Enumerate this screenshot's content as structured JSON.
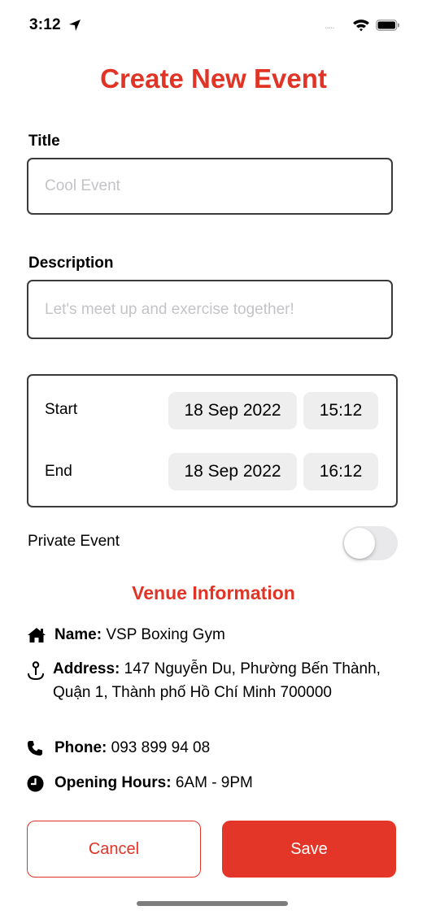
{
  "status_bar": {
    "time": "3:12",
    "signal_dots": "....."
  },
  "page": {
    "title": "Create New Event"
  },
  "form": {
    "title_label": "Title",
    "title_placeholder": "Cool Event",
    "description_label": "Description",
    "description_placeholder": "Let's meet up and exercise together!",
    "start_label": "Start",
    "start_date": "18 Sep 2022",
    "start_time": "15:12",
    "end_label": "End",
    "end_date": "18 Sep 2022",
    "end_time": "16:12",
    "private_label": "Private Event",
    "private_enabled": false
  },
  "venue": {
    "heading": "Venue Information",
    "name_label": "Name:",
    "name_value": "VSP Boxing Gym",
    "address_label": "Address:",
    "address_value": "147 Nguyễn Du, Phường Bến Thành, Quận 1, Thành phố Hồ Chí Minh 700000",
    "phone_label": "Phone:",
    "phone_value": "093 899 94 08",
    "hours_label": "Opening Hours:",
    "hours_value": "6AM - 9PM"
  },
  "actions": {
    "cancel_label": "Cancel",
    "save_label": "Save"
  },
  "icons": {
    "name": "home-icon",
    "address": "map-pin-icon",
    "phone": "phone-icon",
    "hours": "clock-icon"
  },
  "colors": {
    "accent": "#e03426",
    "field_border": "#3a3a3a",
    "pill_bg": "#eeeeef"
  }
}
